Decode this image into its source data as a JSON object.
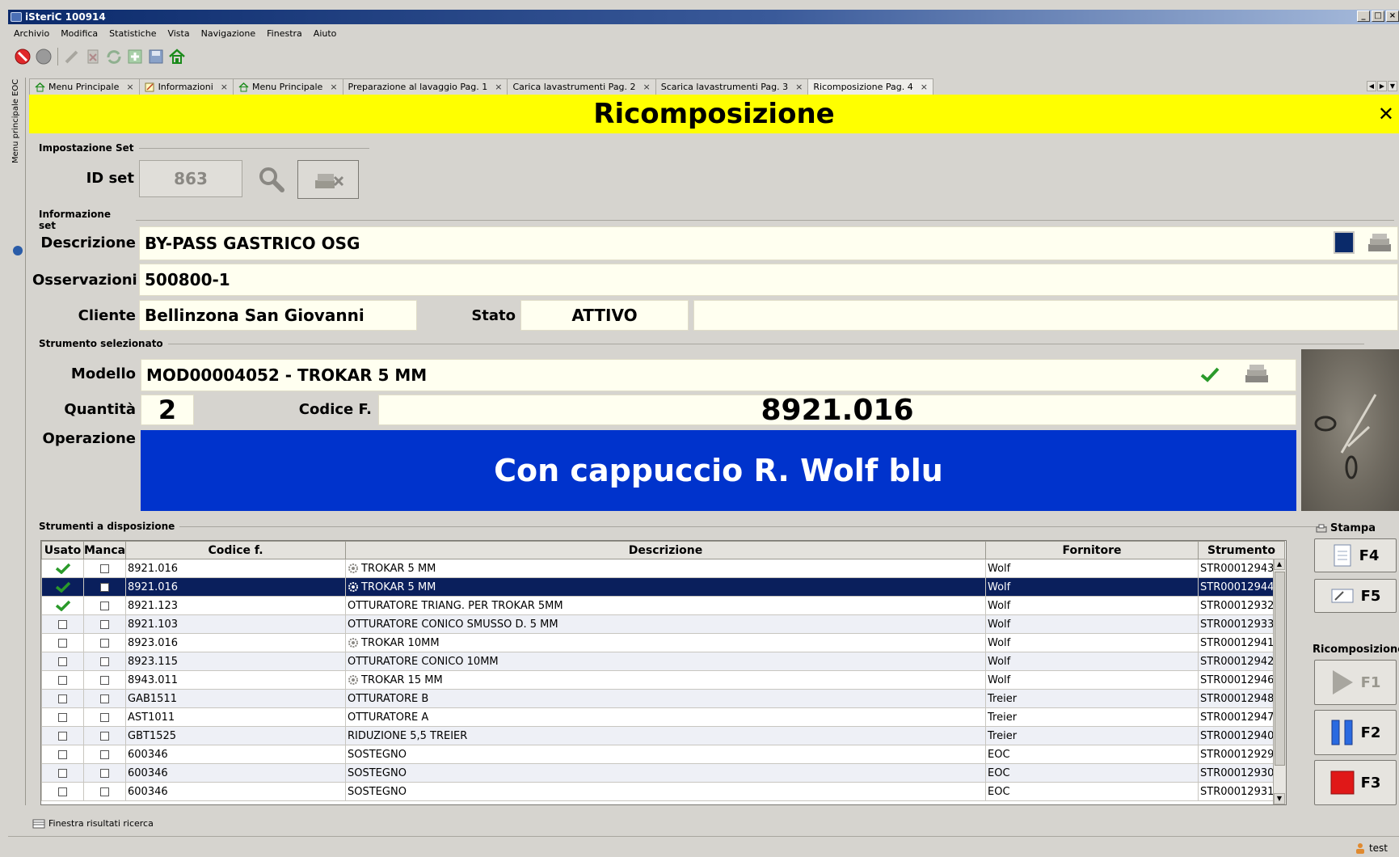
{
  "window": {
    "title": "iSteriC 100914"
  },
  "menu": [
    "Archivio",
    "Modifica",
    "Statistiche",
    "Vista",
    "Navigazione",
    "Finestra",
    "Aiuto"
  ],
  "sidebar": {
    "label": "Menu principale EOC"
  },
  "tabs": [
    {
      "label": "Menu Principale",
      "icon": "home-icon"
    },
    {
      "label": "Informazioni",
      "icon": "info-icon"
    },
    {
      "label": "Menu Principale",
      "icon": "home-icon"
    },
    {
      "label": "Preparazione al lavaggio Pag. 1"
    },
    {
      "label": "Carica lavastrumenti Pag. 2"
    },
    {
      "label": "Scarica lavastrumenti Pag. 3"
    },
    {
      "label": "Ricomposizione Pag. 4",
      "active": true
    }
  ],
  "header": {
    "title": "Ricomposizione"
  },
  "impostazione": {
    "section": "Impostazione Set",
    "id_label": "ID set",
    "id_value": "863"
  },
  "info": {
    "section": "Informazione set",
    "descrizione_label": "Descrizione",
    "descrizione": "BY-PASS GASTRICO OSG",
    "osservazioni_label": "Osservazioni",
    "osservazioni": "500800-1",
    "cliente_label": "Cliente",
    "cliente": "Bellinzona San Giovanni",
    "stato_label": "Stato",
    "stato": "ATTIVO"
  },
  "strumento": {
    "section": "Strumento selezionato",
    "modello_label": "Modello",
    "modello": "MOD00004052 - TROKAR  5 MM",
    "quantita_label": "Quantità",
    "quantita": "2",
    "codice_label": "Codice F.",
    "codice": "8921.016",
    "operazione_label": "Operazione",
    "operazione": "Con cappuccio R. Wolf blu"
  },
  "disposizione": {
    "section": "Strumenti a disposizione",
    "columns": [
      "Usato",
      "Manca",
      "Codice f.",
      "Descrizione",
      "Fornitore",
      "Strumento"
    ],
    "rows": [
      {
        "usato": true,
        "codice": "8921.016",
        "desc": "TROKAR  5 MM",
        "gear": true,
        "fornitore": "Wolf",
        "strumento": "STR00012943"
      },
      {
        "usato": true,
        "codice": "8921.016",
        "desc": "TROKAR  5 MM",
        "gear": true,
        "fornitore": "Wolf",
        "strumento": "STR00012944",
        "selected": true
      },
      {
        "usato": true,
        "codice": "8921.123",
        "desc": "OTTURATORE TRIANG. PER TROKAR 5MM",
        "fornitore": "Wolf",
        "strumento": "STR00012932"
      },
      {
        "usato": false,
        "codice": "8921.103",
        "desc": "OTTURATORE CONICO SMUSSO D. 5 MM",
        "fornitore": "Wolf",
        "strumento": "STR00012933"
      },
      {
        "usato": false,
        "codice": "8923.016",
        "desc": "TROKAR  10MM",
        "gear": true,
        "fornitore": "Wolf",
        "strumento": "STR00012941"
      },
      {
        "usato": false,
        "codice": "8923.115",
        "desc": "OTTURATORE CONICO 10MM",
        "fornitore": "Wolf",
        "strumento": "STR00012942"
      },
      {
        "usato": false,
        "codice": "8943.011",
        "desc": "TROKAR  15 MM",
        "gear": true,
        "fornitore": "Wolf",
        "strumento": "STR00012946"
      },
      {
        "usato": false,
        "codice": "GAB1511",
        "desc": "OTTURATORE B",
        "fornitore": "Treier",
        "strumento": "STR00012948"
      },
      {
        "usato": false,
        "codice": "AST1011",
        "desc": "OTTURATORE A",
        "fornitore": "Treier",
        "strumento": "STR00012947"
      },
      {
        "usato": false,
        "codice": "GBT1525",
        "desc": "RIDUZIONE 5,5 TREIER",
        "fornitore": "Treier",
        "strumento": "STR00012940"
      },
      {
        "usato": false,
        "codice": "600346",
        "desc": "SOSTEGNO",
        "fornitore": "EOC",
        "strumento": "STR00012929"
      },
      {
        "usato": false,
        "codice": "600346",
        "desc": "SOSTEGNO",
        "fornitore": "EOC",
        "strumento": "STR00012930"
      },
      {
        "usato": false,
        "codice": "600346",
        "desc": "SOSTEGNO",
        "fornitore": "EOC",
        "strumento": "STR00012931"
      }
    ]
  },
  "side": {
    "stampa_label": "Stampa",
    "f4": "F4",
    "f5": "F5",
    "ricomposizione_label": "Ricomposizione",
    "f1": "F1",
    "f2": "F2",
    "f3": "F3"
  },
  "status": {
    "results_window": "Finestra risultati ricerca",
    "user": "test"
  },
  "colors": {
    "header_bg": "#ffff00",
    "operazione_bg": "#0033cc",
    "selected_row": "#0a1f5c",
    "field_bg": "#fffff0"
  }
}
